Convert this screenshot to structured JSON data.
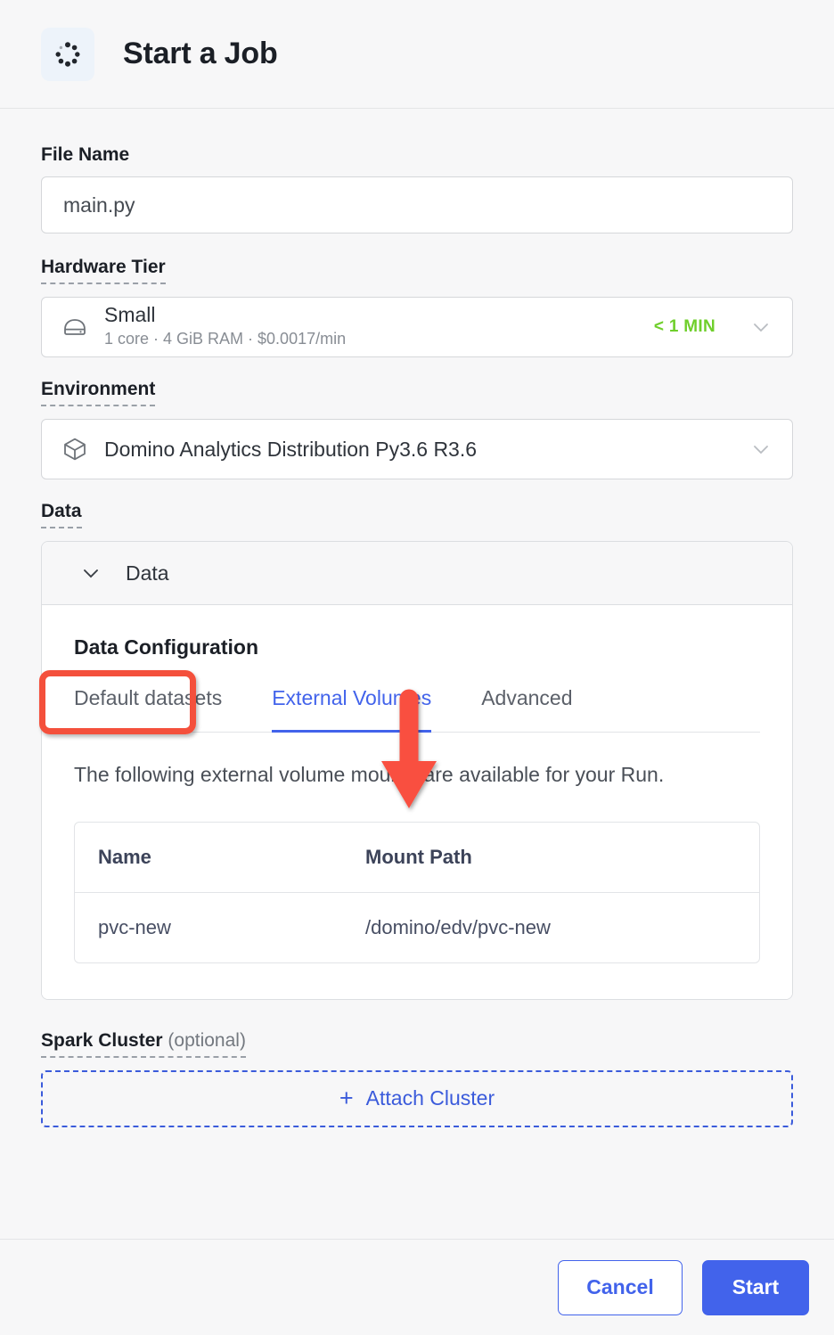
{
  "header": {
    "title": "Start a Job",
    "icon": "spinner-dots-icon"
  },
  "form": {
    "file_name": {
      "label": "File Name",
      "value": "main.py",
      "placeholder": "main.py"
    },
    "hardware_tier": {
      "label": "Hardware Tier",
      "icon": "hard-drive-icon",
      "name": "Small",
      "specs": "1 core · 4 GiB RAM · $0.0017/min",
      "eta": "< 1 MIN",
      "chevron": "chevron-down-icon"
    },
    "environment": {
      "label": "Environment",
      "icon": "cube-icon",
      "value": "Domino Analytics Distribution Py3.6 R3.6",
      "chevron": "chevron-down-icon"
    },
    "data": {
      "label": "Data",
      "accordion_label": "Data",
      "accordion_chevron": "chevron-down-icon",
      "section_title": "Data Configuration",
      "tabs": [
        {
          "label": "Default datasets",
          "active": false
        },
        {
          "label": "External Volumes",
          "active": true
        },
        {
          "label": "Advanced",
          "active": false
        }
      ],
      "description": "The following external volume mounts are available for your Run.",
      "table": {
        "columns": [
          "Name",
          "Mount Path"
        ],
        "rows": [
          [
            "pvc-new",
            "/domino/edv/pvc-new"
          ]
        ]
      }
    },
    "spark_cluster": {
      "label": "Spark Cluster",
      "optional": "(optional)",
      "attach_label": "Attach Cluster",
      "attach_plus": "+"
    }
  },
  "footer": {
    "cancel_label": "Cancel",
    "start_label": "Start"
  },
  "annotations": {
    "highlight_target": "data-accordion-header",
    "arrow_target": "tab-external-volumes",
    "highlight_color": "#f4503c",
    "arrow_color": "#f9503f"
  },
  "colors": {
    "accent_blue": "#4263eb",
    "tab_active": "#4263eb",
    "eta_green": "#6fcf2b",
    "page_bg": "#f7f7f8",
    "card_bg": "#ffffff"
  }
}
